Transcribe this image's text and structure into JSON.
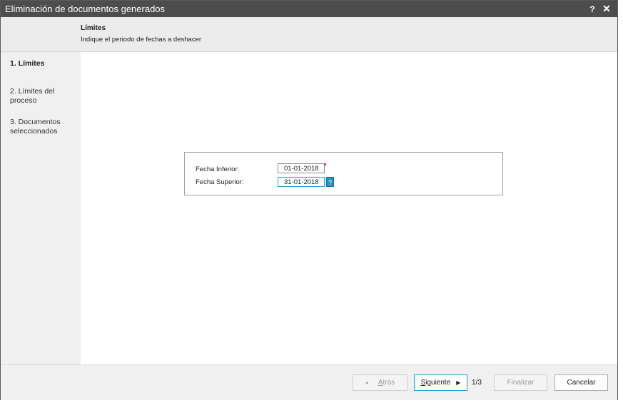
{
  "window": {
    "title": "Eliminación de documentos generados",
    "help_label": "?",
    "close_label": "✕"
  },
  "header": {
    "title": "Límites",
    "subtitle": "Indique el periodo de fechas a deshacer"
  },
  "steps": [
    {
      "label": "1. Límites",
      "active": true
    },
    {
      "label": "2. Límites del proceso",
      "active": false
    },
    {
      "label": "3. Documentos seleccionados",
      "active": false
    }
  ],
  "form": {
    "fecha_inferior": {
      "label": "Fecha Inferior:",
      "value": "01-01-2018"
    },
    "fecha_superior": {
      "label": "Fecha Superior:",
      "value": "31-01-2018"
    },
    "help_glyph": "?"
  },
  "footer": {
    "back": {
      "first": "A",
      "rest": "trás",
      "enabled": false
    },
    "next": {
      "first": "S",
      "rest": "iguiente",
      "enabled": true
    },
    "page_indicator": "1/3",
    "finish": {
      "label": "Finalizar",
      "enabled": false
    },
    "cancel": {
      "label": "Cancelar",
      "enabled": true
    }
  },
  "colors": {
    "titlebar": "#4d4d4d",
    "focus_accent": "#2e9ec8",
    "help_button": "#2b8fc0"
  }
}
